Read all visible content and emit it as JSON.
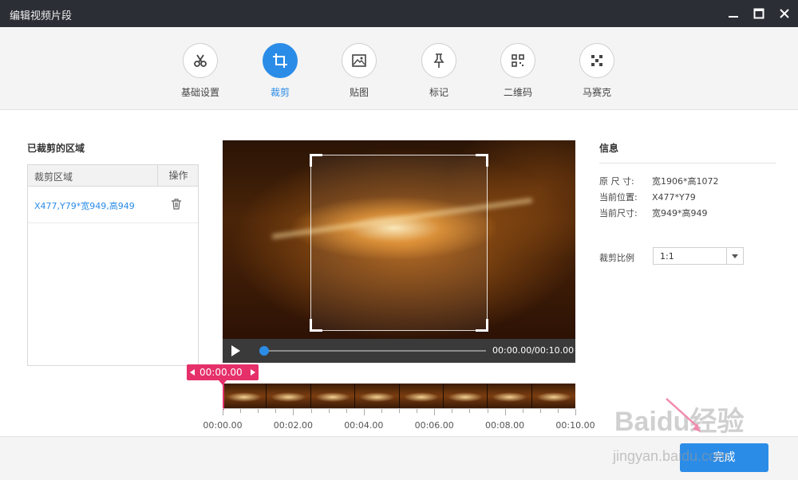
{
  "window": {
    "title": "编辑视频片段",
    "controls": {
      "minimize_icon": "minimize-icon",
      "maximize_icon": "maximize-icon",
      "close_icon": "close-icon"
    }
  },
  "tabs": [
    {
      "label": "基础设置",
      "icon": "scissors-icon",
      "active": false
    },
    {
      "label": "裁剪",
      "icon": "crop-icon",
      "active": true
    },
    {
      "label": "贴图",
      "icon": "image-icon",
      "active": false
    },
    {
      "label": "标记",
      "icon": "pin-icon",
      "active": false
    },
    {
      "label": "二维码",
      "icon": "qrcode-icon",
      "active": false
    },
    {
      "label": "马赛克",
      "icon": "mosaic-icon",
      "active": false
    }
  ],
  "cropped_list": {
    "heading": "已裁剪的区域",
    "columns": {
      "region": "裁剪区域",
      "action": "操作"
    },
    "rows": [
      {
        "region": "X477,Y79*宽949,高949",
        "action_icon": "trash-icon"
      }
    ]
  },
  "player": {
    "timecode": "00:00.00/00:10.00",
    "progress_fraction": 0.0,
    "play_icon": "play-icon"
  },
  "timeline": {
    "current_time": "00:00.00",
    "ticks": [
      "00:00.00",
      "00:02.00",
      "00:04.00",
      "00:06.00",
      "00:08.00",
      "00:10.00"
    ],
    "frame_count": 8
  },
  "info": {
    "title": "信息",
    "rows": [
      {
        "key": "原 尺 寸:",
        "value": "宽1906*高1072"
      },
      {
        "key": "当前位置:",
        "value": "X477*Y79"
      },
      {
        "key": "当前尺寸:",
        "value": "宽949*高949"
      }
    ],
    "ratio_label": "裁剪比例",
    "ratio_value": "1:1"
  },
  "footer": {
    "done_label": "完成"
  },
  "watermark": {
    "text": "Baidu经验",
    "subtext": "jingyan.baidu.com"
  },
  "colors": {
    "accent": "#2b8ce8",
    "timeline_marker": "#e5306a",
    "titlebar": "#2b2e35"
  }
}
